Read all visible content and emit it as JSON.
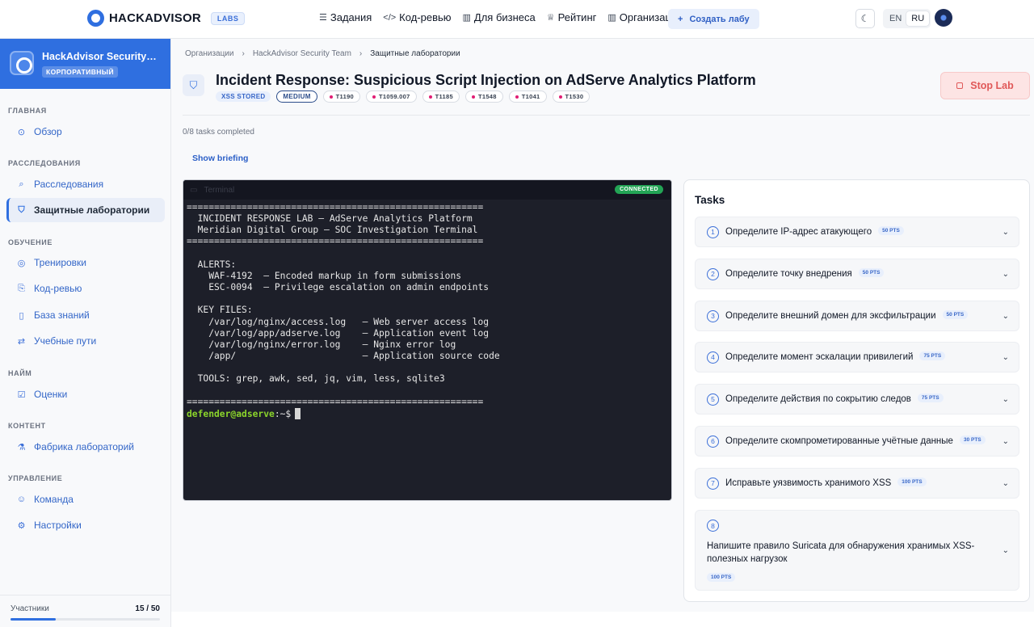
{
  "topbar": {
    "brand": "HACKADVISOR",
    "brand_badge": "LABS",
    "nav": [
      {
        "icon": "list-icon",
        "label": "Задания"
      },
      {
        "icon": "code-icon",
        "label": "Код-ревью"
      },
      {
        "icon": "building-icon",
        "label": "Для бизнеса"
      },
      {
        "icon": "trophy-icon",
        "label": "Рейтинг"
      },
      {
        "icon": "building-icon",
        "label": "Организации"
      }
    ],
    "create_label": "Создать лабу",
    "lang_en": "EN",
    "lang_ru": "RU",
    "lang_active": "RU"
  },
  "sidebar": {
    "org_name": "HackAdvisor Security…",
    "org_tag": "КОРПОРАТИВНЫЙ",
    "sections": {
      "main": "ГЛАВНАЯ",
      "investigations": "РАССЛЕДОВАНИЯ",
      "learning": "ОБУЧЕНИЕ",
      "hiring": "НАЙМ",
      "content": "КОНТЕНТ",
      "management": "УПРАВЛЕНИЕ"
    },
    "items": {
      "overview": "Обзор",
      "investigations": "Расследования",
      "defense_labs": "Защитные лаборатории",
      "trainings": "Тренировки",
      "code_review": "Код-ревью",
      "knowledge_base": "База знаний",
      "learning_paths": "Учебные пути",
      "assessments": "Оценки",
      "lab_factory": "Фабрика лабораторий",
      "team": "Команда",
      "settings": "Настройки"
    },
    "members_label": "Участники",
    "members_count": "15 / 50",
    "members_fraction": 0.3
  },
  "breadcrumb": [
    "Организации",
    "HackAdvisor Security Team",
    "Защитные лаборатории"
  ],
  "lab": {
    "title": "Incident Response: Suspicious Script Injection on AdServe Analytics Platform",
    "category": "XSS STORED",
    "difficulty": "MEDIUM",
    "ttps": [
      "T1190",
      "T1059.007",
      "T1185",
      "T1548",
      "T1041",
      "T1530"
    ],
    "stop_label": "Stop Lab",
    "progress_text": "0/8 tasks completed",
    "briefing_label": "Show briefing"
  },
  "terminal": {
    "label": "Terminal",
    "status": "CONNECTED",
    "lines": "======================================================\n  INCIDENT RESPONSE LAB — AdServe Analytics Platform\n  Meridian Digital Group — SOC Investigation Terminal\n======================================================\n\n  ALERTS:\n    WAF-4192  — Encoded markup in form submissions\n    ESC-0094  — Privilege escalation on admin endpoints\n\n  KEY FILES:\n    /var/log/nginx/access.log   — Web server access log\n    /var/log/app/adserve.log    — Application event log\n    /var/log/nginx/error.log    — Nginx error log\n    /app/                       — Application source code\n\n  TOOLS: grep, awk, sed, jq, vim, less, sqlite3\n\n======================================================",
    "prompt_user": "defender@adserve",
    "prompt_path": ":~$"
  },
  "tasks": {
    "title": "Tasks",
    "items": [
      {
        "num": "1",
        "label": "Определите IP-адрес атакующего",
        "pts": "50 PTS"
      },
      {
        "num": "2",
        "label": "Определите точку внедрения",
        "pts": "50 PTS"
      },
      {
        "num": "3",
        "label": "Определите внешний домен для эксфильтрации",
        "pts": "50 PTS"
      },
      {
        "num": "4",
        "label": "Определите момент эскалации привилегий",
        "pts": "75 PTS"
      },
      {
        "num": "5",
        "label": "Определите действия по сокрытию следов",
        "pts": "75 PTS"
      },
      {
        "num": "6",
        "label": "Определите скомпрометированные учётные данные",
        "pts": "30 PTS"
      },
      {
        "num": "7",
        "label": "Исправьте уязвимость хранимого XSS",
        "pts": "100 PTS"
      },
      {
        "num": "8",
        "label": "Напишите правило Suricata для обнаружения хранимых XSS-полезных нагрузок",
        "pts": "100 PTS"
      }
    ]
  }
}
